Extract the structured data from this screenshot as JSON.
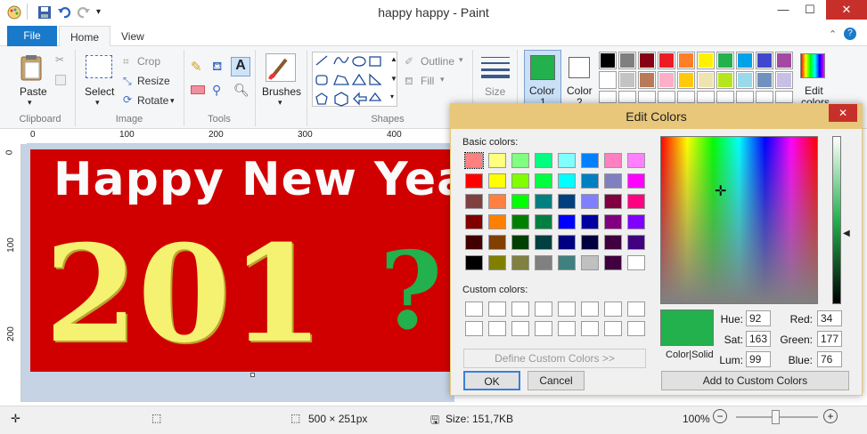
{
  "window": {
    "title": "happy happy - Paint"
  },
  "tabs": {
    "file": "File",
    "home": "Home",
    "view": "View"
  },
  "clipboard": {
    "paste": "Paste",
    "label": "Clipboard"
  },
  "image": {
    "select": "Select",
    "crop": "Crop",
    "resize": "Resize",
    "rotate": "Rotate",
    "label": "Image"
  },
  "tools": {
    "label": "Tools"
  },
  "brushes": {
    "label": "Brushes"
  },
  "shapes": {
    "outline": "Outline",
    "fill": "Fill",
    "label": "Shapes"
  },
  "size": {
    "label": "Size"
  },
  "colors": {
    "color1": "Color",
    "color1_num": "1",
    "color2": "Color",
    "color2_num": "2",
    "edit": "Edit",
    "edit2": "colors",
    "palette_row1": [
      "#000000",
      "#7f7f7f",
      "#880015",
      "#ed1c24",
      "#ff7f27",
      "#fff200",
      "#22b14c",
      "#00a2e8",
      "#3f48cc",
      "#a349a4"
    ],
    "palette_row2": [
      "#ffffff",
      "#c3c3c3",
      "#b97a57",
      "#ffaec9",
      "#ffc90e",
      "#efe4b0",
      "#b5e61d",
      "#99d9ea",
      "#7092be",
      "#c8bfe7"
    ]
  },
  "ruler": {
    "top": [
      "0",
      "100",
      "200",
      "300",
      "400"
    ],
    "left": [
      "0",
      "100",
      "200"
    ]
  },
  "canvas": {
    "line1": "Happy New Year",
    "line2": "201",
    "line2b": "?"
  },
  "status": {
    "dimensions": "500 × 251px",
    "size": "Size: 151,7KB",
    "zoom": "100%"
  },
  "dialog": {
    "title": "Edit Colors",
    "basic_label": "Basic colors:",
    "custom_label": "Custom colors:",
    "define_button": "Define Custom Colors >>",
    "ok": "OK",
    "cancel": "Cancel",
    "add_button": "Add to Custom Colors",
    "color_solid": "Color|Solid",
    "hue_label": "Hue:",
    "hue": "92",
    "sat_label": "Sat:",
    "sat": "163",
    "lum_label": "Lum:",
    "lum": "99",
    "red_label": "Red:",
    "red": "34",
    "green_label": "Green:",
    "green": "177",
    "blue_label": "Blue:",
    "blue": "76",
    "current_color": "#22b14c",
    "basic_colors": [
      [
        "#ff8080",
        "#ffff80",
        "#80ff80",
        "#00ff80",
        "#80ffff",
        "#0080ff",
        "#ff80c0",
        "#ff80ff"
      ],
      [
        "#ff0000",
        "#ffff00",
        "#80ff00",
        "#00ff40",
        "#00ffff",
        "#0080c0",
        "#8080c0",
        "#ff00ff"
      ],
      [
        "#804040",
        "#ff8040",
        "#00ff00",
        "#008080",
        "#004080",
        "#8080ff",
        "#800040",
        "#ff0080"
      ],
      [
        "#800000",
        "#ff8000",
        "#008000",
        "#008040",
        "#0000ff",
        "#0000a0",
        "#800080",
        "#8000ff"
      ],
      [
        "#400000",
        "#804000",
        "#004000",
        "#004040",
        "#000080",
        "#000040",
        "#400040",
        "#400080"
      ],
      [
        "#000000",
        "#808000",
        "#808040",
        "#808080",
        "#408080",
        "#c0c0c0",
        "#400040",
        "#ffffff"
      ]
    ]
  }
}
